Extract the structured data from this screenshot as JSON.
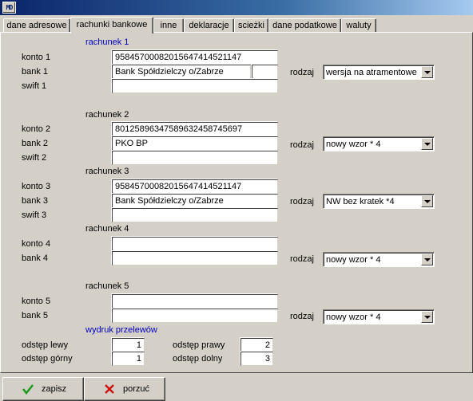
{
  "window": {
    "icon_label": "MD",
    "title": ""
  },
  "tabs": [
    {
      "label": "dane adresowe",
      "active": false
    },
    {
      "label": "rachunki bankowe",
      "active": true
    },
    {
      "label": "inne",
      "active": false
    },
    {
      "label": "deklaracje",
      "active": false
    },
    {
      "label": "scieżki",
      "active": false
    },
    {
      "label": "dane podatkowe",
      "active": false
    },
    {
      "label": "waluty",
      "active": false
    }
  ],
  "labels": {
    "rodzaj": "rodzaj"
  },
  "accounts": [
    {
      "header": "rachunek 1",
      "konto_label": "konto  1",
      "bank_label": "bank   1",
      "swift_label": "swift 1",
      "konto": "95845700082015647414521147",
      "bank": "Bank Spółdzielczy o/Zabrze",
      "bank_extra": "",
      "swift": "",
      "rodzaj": "wersja na atramentowe c"
    },
    {
      "header": "rachunek 2",
      "konto_label": "konto  2",
      "bank_label": "bank   2",
      "swift_label": "swift 2",
      "konto": "80125896347589632458745697",
      "bank": "PKO BP",
      "swift": "",
      "rodzaj": "nowy wzor * 4"
    },
    {
      "header": "rachunek 3",
      "konto_label": "konto  3",
      "bank_label": "bank   3",
      "swift_label": "swift 3",
      "konto": "95845700082015647414521147",
      "bank": "Bank Spółdzielczy o/Zabrze",
      "swift": "",
      "rodzaj": "NW bez kratek *4"
    },
    {
      "header": "rachunek 4",
      "konto_label": "konto  4",
      "bank_label": "bank   4",
      "konto": "",
      "bank": "",
      "rodzaj": "nowy wzor * 4"
    },
    {
      "header": "rachunek 5",
      "konto_label": "konto  5",
      "bank_label": "bank   5",
      "konto": "",
      "bank": "",
      "rodzaj": "nowy wzor * 4"
    }
  ],
  "print": {
    "header": "wydruk przelewów",
    "left_label": "odstęp lewy",
    "left": "1",
    "top_label": "odstęp górny",
    "top": "1",
    "right_label": "odstęp prawy",
    "right": "2",
    "bottom_label": "odstęp dolny",
    "bottom": "3"
  },
  "buttons": {
    "save": "zapisz",
    "cancel": "porzuć"
  },
  "colors": {
    "section_blue": "#0000c0",
    "save_icon": "#1a9a1a",
    "cancel_icon": "#d01010"
  }
}
